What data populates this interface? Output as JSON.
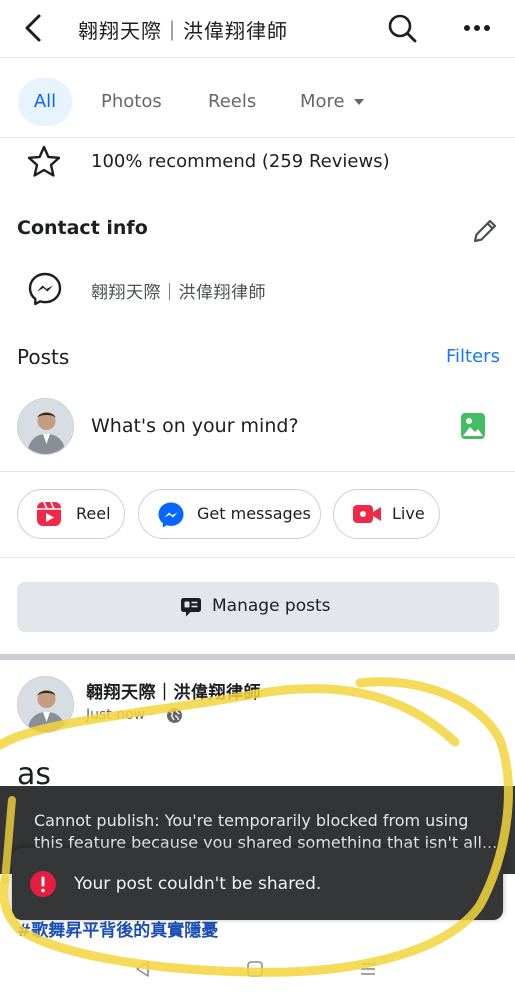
{
  "header": {
    "title": "翱翔天際｜洪偉翔律師"
  },
  "tabs": [
    {
      "label": "All"
    },
    {
      "label": "Photos"
    },
    {
      "label": "Reels"
    },
    {
      "label": "More"
    }
  ],
  "recommend": {
    "text": "100% recommend (259 Reviews)"
  },
  "contact": {
    "title": "Contact info",
    "messenger_name": "翱翔天際｜洪偉翔律師"
  },
  "posts": {
    "title": "Posts",
    "filters_label": "Filters",
    "composer_prompt": "What's on your mind?",
    "actions": [
      {
        "label": "Reel"
      },
      {
        "label": "Get messages"
      },
      {
        "label": "Live"
      }
    ],
    "manage_label": "Manage posts"
  },
  "post": {
    "author": "翱翔天際｜洪偉翔律師",
    "time": "Just now ·",
    "body": "as",
    "hashtag": "#歌舞昇平背後的真實隱憂"
  },
  "toasts": {
    "publish_error_line1": "Cannot publish: You're temporarily blocked from using",
    "publish_error_line2": "this feature because you shared something that isn't all...",
    "share_error": "Your post couldn't be shared."
  },
  "colors": {
    "accent": "#1877f2",
    "active_tab_bg": "#e7f3ff",
    "error": "#e41e3f",
    "highlighter": "#f2d53c",
    "toast_bg": "#353637"
  }
}
